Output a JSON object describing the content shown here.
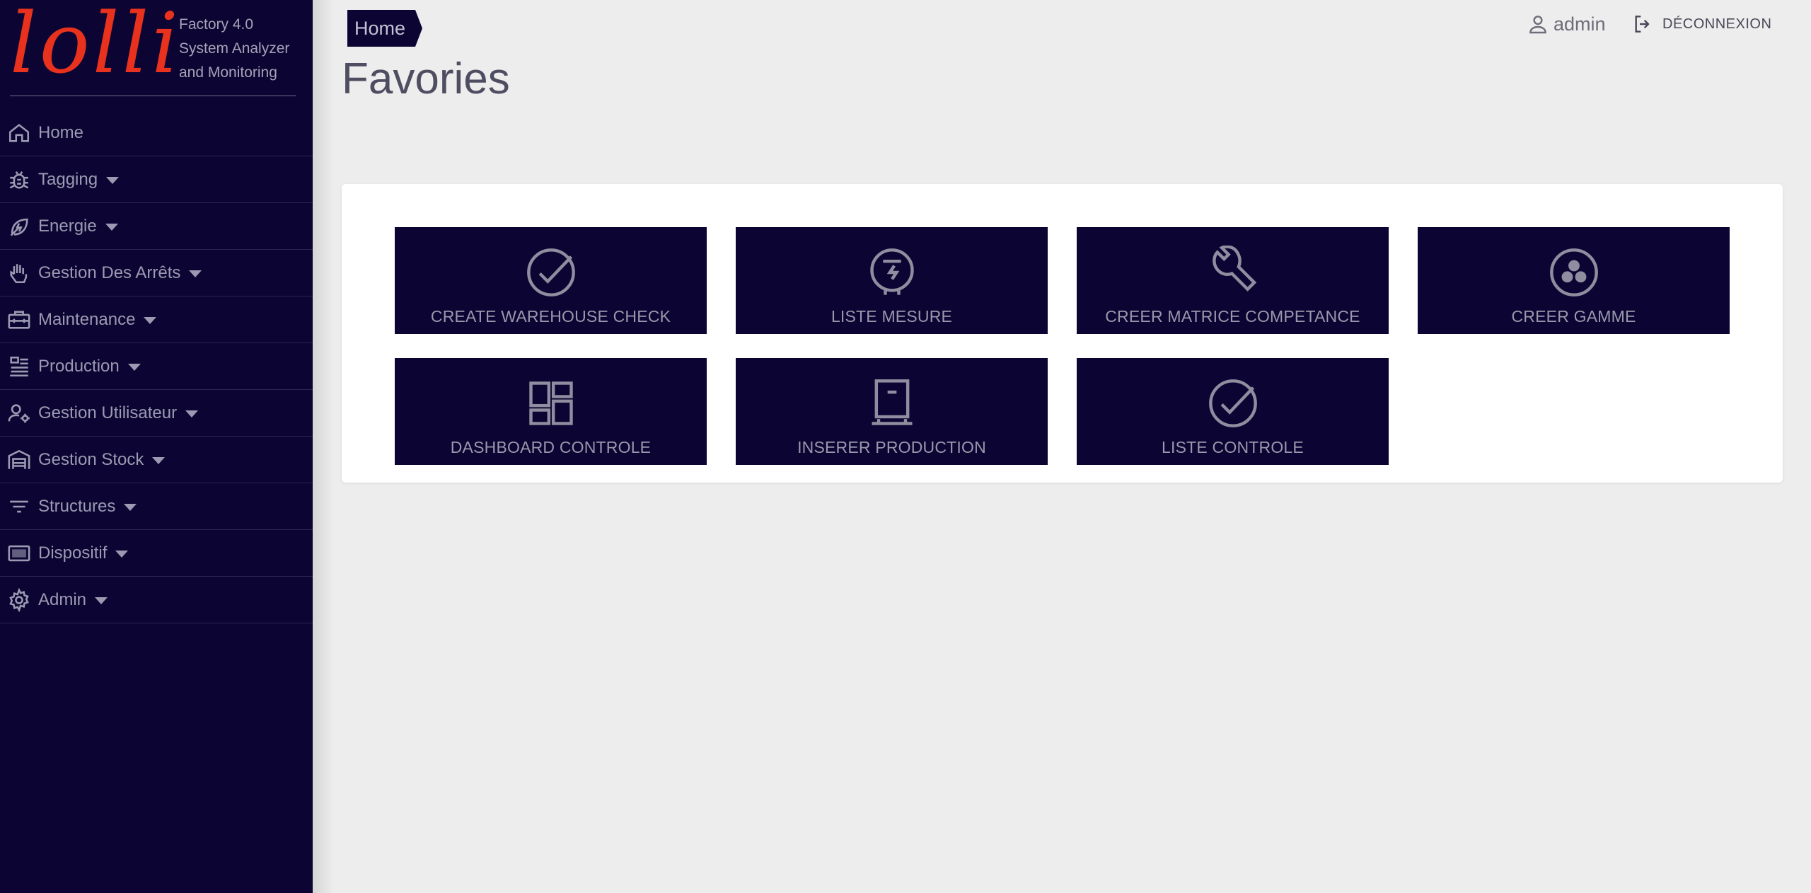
{
  "brand": {
    "logo_text": "lolli",
    "tagline_line1": "Factory 4.0",
    "tagline_line2": "System Analyzer",
    "tagline_line3": "and Monitoring",
    "logo_color": "#e8321e",
    "sidebar_color": "#0c0533"
  },
  "sidebar": {
    "items": [
      {
        "label": "Home",
        "icon": "home-icon",
        "expandable": false
      },
      {
        "label": "Tagging",
        "icon": "bug-icon",
        "expandable": true
      },
      {
        "label": "Energie",
        "icon": "eco-leaf-icon",
        "expandable": true
      },
      {
        "label": "Gestion Des Arrêts",
        "icon": "hand-stop-icon",
        "expandable": true
      },
      {
        "label": "Maintenance",
        "icon": "toolbox-icon",
        "expandable": true
      },
      {
        "label": "Production",
        "icon": "production-list-icon",
        "expandable": true
      },
      {
        "label": "Gestion Utilisateur",
        "icon": "user-settings-icon",
        "expandable": true
      },
      {
        "label": "Gestion Stock",
        "icon": "warehouse-icon",
        "expandable": true
      },
      {
        "label": "Structures",
        "icon": "filter-list-icon",
        "expandable": true
      },
      {
        "label": "Dispositif",
        "icon": "device-icon",
        "expandable": true
      },
      {
        "label": "Admin",
        "icon": "gear-icon",
        "expandable": true
      }
    ]
  },
  "header": {
    "breadcrumb": "Home",
    "page_title": "Favories",
    "user_name": "admin",
    "logout_label": "DÉCONNEXION"
  },
  "favorites": [
    {
      "label": "CREATE WAREHOUSE CHECK",
      "icon": "check-circle-icon"
    },
    {
      "label": "LISTE MESURE",
      "icon": "meter-icon"
    },
    {
      "label": "CREER MATRICE COMPETANCE",
      "icon": "wrench-icon"
    },
    {
      "label": "CREER GAMME",
      "icon": "workspaces-icon"
    },
    {
      "label": "DASHBOARD CONTROLE",
      "icon": "dashboard-icon"
    },
    {
      "label": "INSERER PRODUCTION",
      "icon": "pallet-box-icon"
    },
    {
      "label": "LISTE CONTROLE",
      "icon": "check-circle-icon"
    }
  ]
}
